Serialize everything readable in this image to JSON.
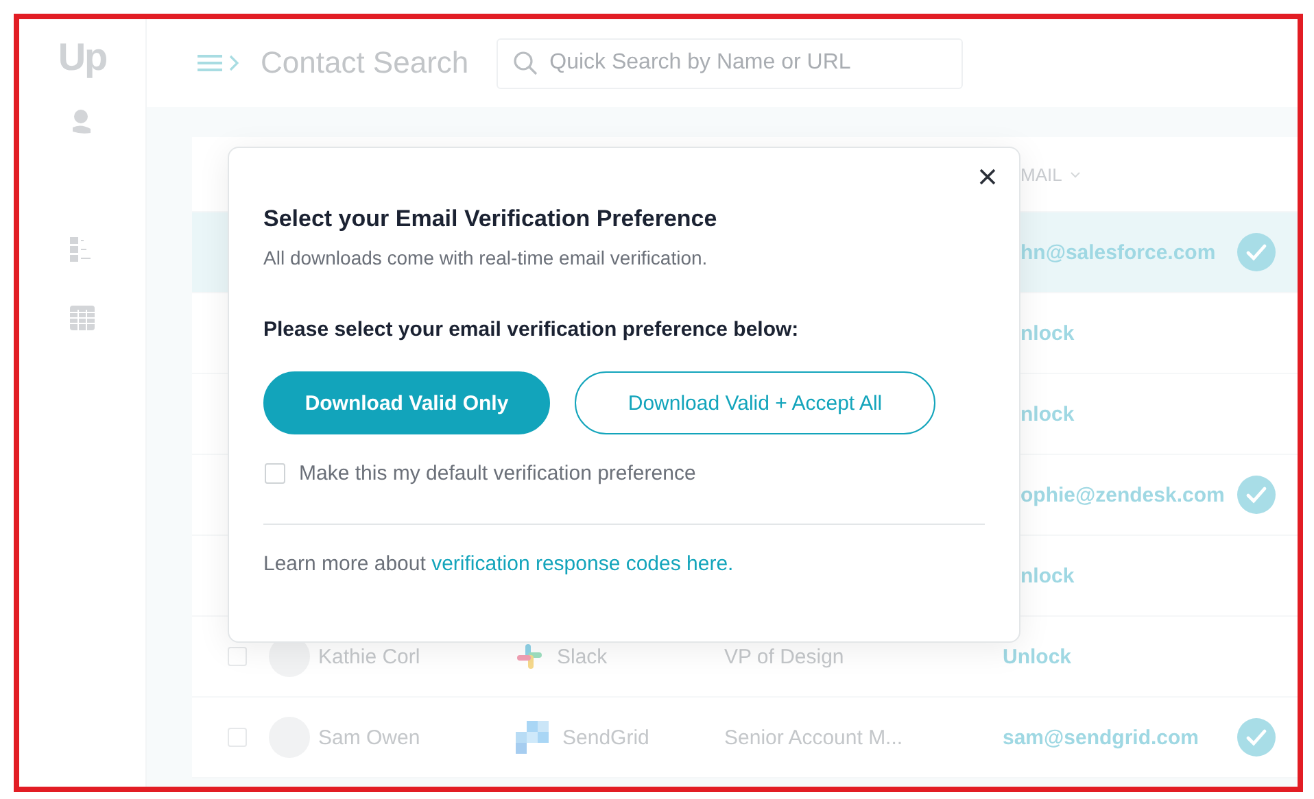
{
  "sidebar": {
    "logo": "Up"
  },
  "header": {
    "title": "Contact Search",
    "search": {
      "placeholder": "Quick Search by Name or URL"
    }
  },
  "table": {
    "columns": [
      {
        "label": "MAIL"
      }
    ],
    "rows": [
      {
        "kind": "covered",
        "selected": true,
        "email": "hn@salesforce.com",
        "verified": true
      },
      {
        "kind": "covered",
        "selected": false,
        "email": "nlock",
        "verified": false
      },
      {
        "kind": "covered",
        "selected": false,
        "email": "nlock",
        "verified": false
      },
      {
        "kind": "covered",
        "selected": false,
        "email": "ophie@zendesk.com",
        "verified": true
      },
      {
        "kind": "covered",
        "selected": false,
        "email": "nlock",
        "verified": false
      },
      {
        "kind": "bars",
        "selected": false,
        "checked": false,
        "name": "Kathie Corl",
        "company": "Slack",
        "title": "VP of Design",
        "email": "Unlock",
        "verified": false
      },
      {
        "kind": "squares",
        "selected": false,
        "checked": false,
        "name": "Sam Owen",
        "company": "SendGrid",
        "title": "Senior Account M...",
        "email": "sam@sendgrid.com",
        "verified": true
      }
    ]
  },
  "modal": {
    "title": "Select your Email Verification Preference",
    "subtitle": "All downloads come with real-time email verification.",
    "prompt": "Please select your email verification preference below:",
    "buttons": [
      {
        "label": "Download Valid Only",
        "kind": "primary"
      },
      {
        "label": "Download Valid + Accept All",
        "kind": "outline"
      }
    ],
    "checkbox": {
      "label": "Make this my default verification preference",
      "checked": false
    },
    "footer": {
      "text": "Learn more about",
      "link": "verification response codes here."
    }
  }
}
